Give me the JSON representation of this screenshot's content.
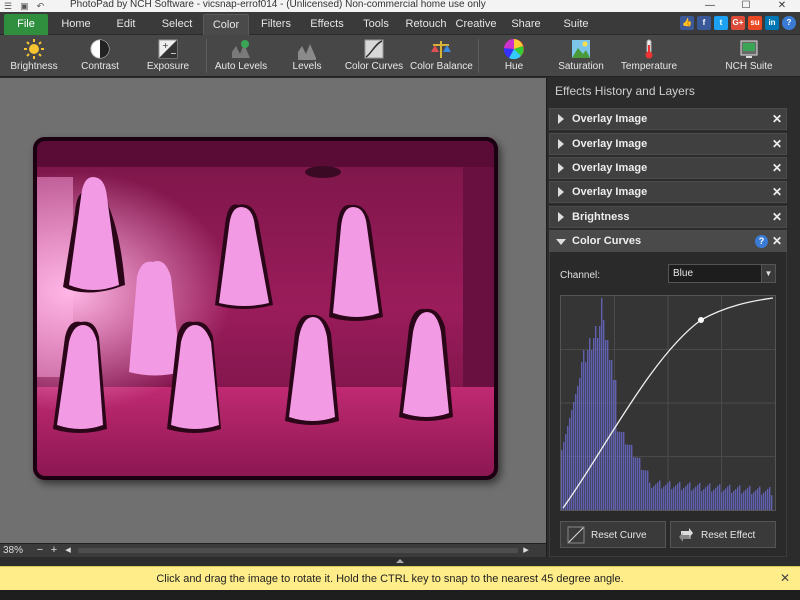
{
  "window": {
    "title": "PhotoPad by NCH Software - vicsnap-errof014 - (Unlicensed) Non-commercial home use only",
    "min": "—",
    "max": "☐",
    "close": "✕"
  },
  "menu": {
    "tabs": [
      {
        "label": "File"
      },
      {
        "label": "Home"
      },
      {
        "label": "Edit"
      },
      {
        "label": "Select"
      },
      {
        "label": "Color"
      },
      {
        "label": "Filters"
      },
      {
        "label": "Effects"
      },
      {
        "label": "Tools"
      },
      {
        "label": "Retouch"
      },
      {
        "label": "Creative"
      },
      {
        "label": "Share"
      },
      {
        "label": "Suite"
      }
    ],
    "active": "Color",
    "social": [
      {
        "icon": "thumbs-up-icon",
        "glyph": "👍",
        "color": "#3b5998"
      },
      {
        "icon": "facebook-icon",
        "glyph": "f",
        "color": "#3b5998"
      },
      {
        "icon": "twitter-icon",
        "glyph": "t",
        "color": "#1da1f2"
      },
      {
        "icon": "google-plus-icon",
        "glyph": "G+",
        "color": "#dd4b39"
      },
      {
        "icon": "stumbleupon-icon",
        "glyph": "su",
        "color": "#eb4924"
      },
      {
        "icon": "linkedin-icon",
        "glyph": "in",
        "color": "#0077b5"
      }
    ],
    "help": "?"
  },
  "ribbon": {
    "buttons": [
      {
        "name": "brightness-button",
        "label": "Brightness",
        "icon": "sun-icon"
      },
      {
        "name": "contrast-button",
        "label": "Contrast",
        "icon": "contrast-icon"
      },
      {
        "name": "exposure-button",
        "label": "Exposure",
        "icon": "exposure-icon"
      },
      {
        "name": "auto-levels-button",
        "label": "Auto Levels",
        "icon": "auto-levels-icon"
      },
      {
        "name": "levels-button",
        "label": "Levels",
        "icon": "levels-icon"
      },
      {
        "name": "color-curves-button",
        "label": "Color Curves",
        "icon": "color-curves-icon"
      },
      {
        "name": "color-balance-button",
        "label": "Color Balance",
        "icon": "color-balance-icon"
      },
      {
        "name": "hue-button",
        "label": "Hue",
        "icon": "hue-wheel-icon"
      },
      {
        "name": "saturation-button",
        "label": "Saturation",
        "icon": "saturation-icon"
      },
      {
        "name": "temperature-button",
        "label": "Temperature",
        "icon": "thermometer-icon"
      },
      {
        "name": "nch-suite-button",
        "label": "NCH Suite",
        "icon": "nch-suite-icon"
      }
    ]
  },
  "canvas": {
    "zoom": "38%",
    "zoom_out": "−",
    "zoom_in": "+",
    "scroll_left": "◂",
    "scroll_right": "▸"
  },
  "panel": {
    "title": "Effects History and Layers",
    "layers": [
      {
        "label": "Overlay Image"
      },
      {
        "label": "Overlay Image"
      },
      {
        "label": "Overlay Image"
      },
      {
        "label": "Overlay Image"
      },
      {
        "label": "Brightness"
      }
    ],
    "active_layer": "Color Curves",
    "close_glyph": "✕",
    "help_glyph": "?",
    "channel_label": "Channel:",
    "channel_value": "Blue",
    "reset_curve": "Reset Curve",
    "reset_effect": "Reset Effect"
  },
  "status": {
    "message": "Click and drag the image to rotate it. Hold the CTRL key to snap to the nearest 45 degree angle.",
    "close": "✕"
  }
}
